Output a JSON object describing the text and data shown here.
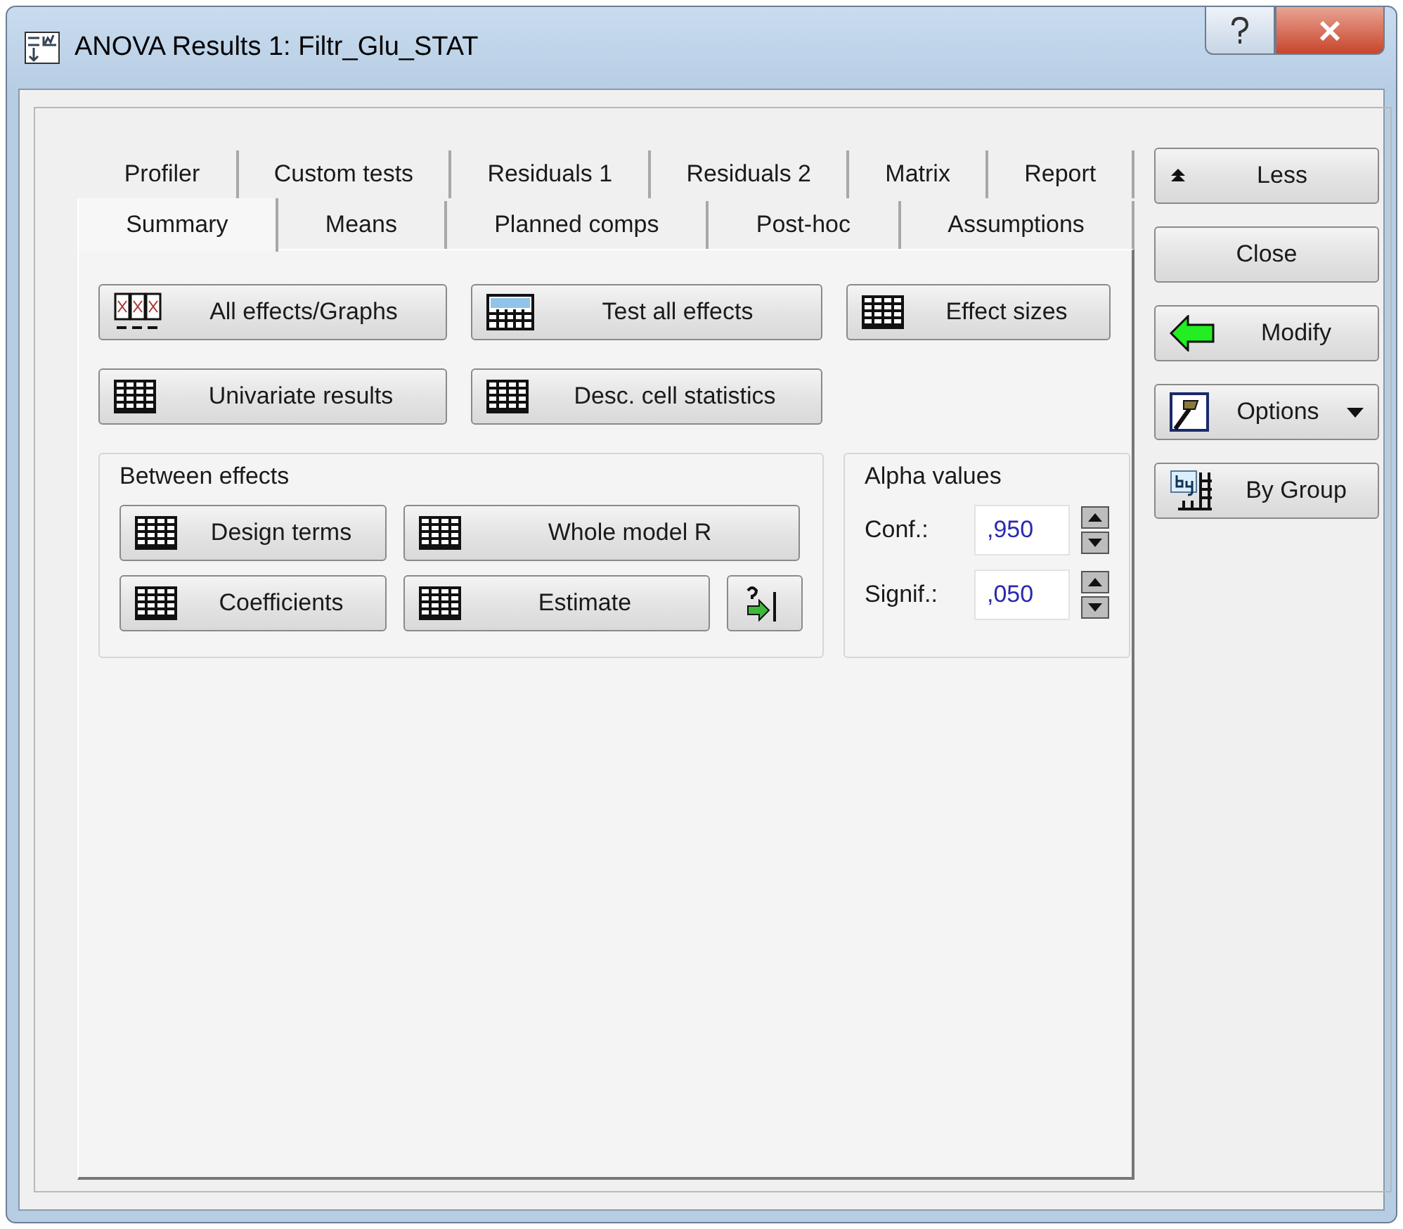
{
  "window": {
    "title": "ANOVA Results 1: Filtr_Glu_STAT"
  },
  "tab_rows": [
    [
      {
        "label": "Profiler",
        "selected": false
      },
      {
        "label": "Custom tests",
        "selected": false
      },
      {
        "label": "Residuals 1",
        "selected": false
      },
      {
        "label": "Residuals 2",
        "selected": false
      },
      {
        "label": "Matrix",
        "selected": false
      },
      {
        "label": "Report",
        "selected": false
      }
    ],
    [
      {
        "label": "Summary",
        "selected": true
      },
      {
        "label": "Means",
        "selected": false
      },
      {
        "label": "Planned comps",
        "selected": false
      },
      {
        "label": "Post-hoc",
        "selected": false
      },
      {
        "label": "Assumptions",
        "selected": false
      }
    ]
  ],
  "summary_buttons": [
    [
      {
        "label": "All effects/Graphs",
        "kind": "effects"
      },
      {
        "label": "Test all effects",
        "kind": "summ"
      },
      {
        "label": "Effect sizes",
        "kind": "grid"
      }
    ],
    [
      {
        "label": "Univariate results",
        "kind": "grid"
      },
      {
        "label": "Desc. cell statistics",
        "kind": "grid"
      }
    ]
  ],
  "between_effects": {
    "title": "Between effects",
    "rows": [
      [
        {
          "label": "Design terms",
          "kind": "grid"
        },
        {
          "label": "Whole model R",
          "kind": "grid"
        }
      ],
      [
        {
          "label": "Coefficients",
          "kind": "grid"
        },
        {
          "label": "Estimate",
          "kind": "grid"
        },
        {
          "kind": "help"
        }
      ]
    ]
  },
  "alpha_values": {
    "title": "Alpha values",
    "fields": [
      {
        "label": "Conf.:",
        "value": ",950"
      },
      {
        "label": "Signif.:",
        "value": ",050"
      }
    ]
  },
  "side_buttons": [
    {
      "label": "Less",
      "kind": "up"
    },
    {
      "label": "Close",
      "kind": "plain"
    },
    {
      "label": "Modify",
      "kind": "back"
    },
    {
      "label": "Options",
      "kind": "hammer",
      "dropdown": true
    },
    {
      "label": "By Group",
      "kind": "by"
    }
  ]
}
